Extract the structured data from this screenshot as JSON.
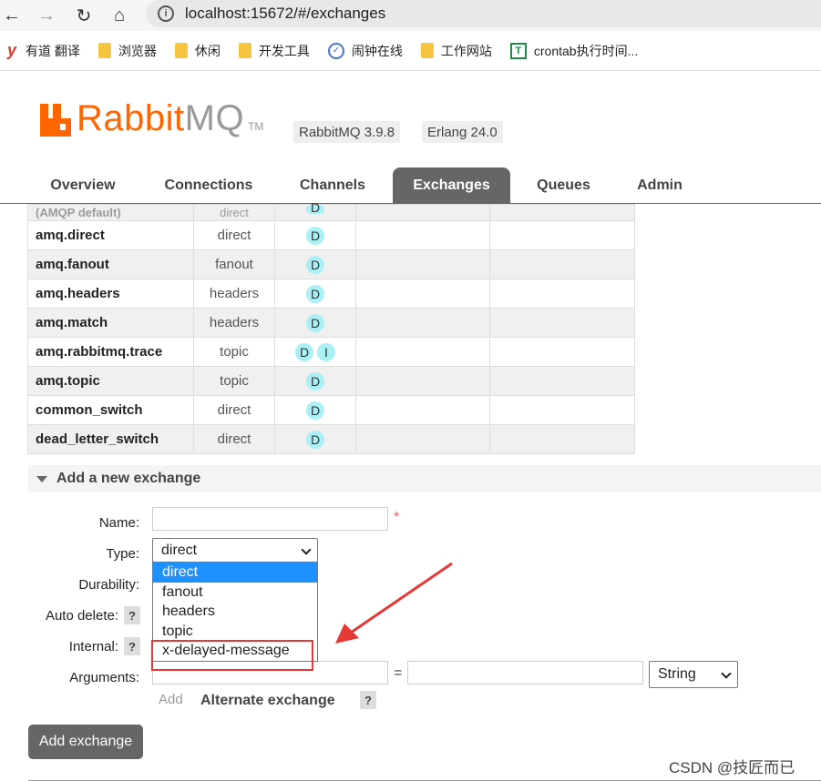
{
  "browser": {
    "url": "localhost:15672/#/exchanges",
    "bookmarks": [
      {
        "icon": "youdao-icon",
        "label": "有道 翻译"
      },
      {
        "icon": "folder-icon",
        "label": "浏览器"
      },
      {
        "icon": "folder-icon",
        "label": "休闲"
      },
      {
        "icon": "folder-icon",
        "label": "开发工具"
      },
      {
        "icon": "clock-check-icon",
        "label": "闹钟在线"
      },
      {
        "icon": "folder-icon",
        "label": "工作网站"
      },
      {
        "icon": "sheet-icon",
        "label": "crontab执行时间..."
      }
    ]
  },
  "header": {
    "logo_rabbit": "Rabbit",
    "logo_mq": "MQ",
    "logo_tm": "TM",
    "version": "RabbitMQ 3.9.8",
    "erlang": "Erlang 24.0",
    "brand_color": "#ff6600"
  },
  "tabs": [
    {
      "label": "Overview",
      "active": false
    },
    {
      "label": "Connections",
      "active": false
    },
    {
      "label": "Channels",
      "active": false
    },
    {
      "label": "Exchanges",
      "active": true
    },
    {
      "label": "Queues",
      "active": false
    },
    {
      "label": "Admin",
      "active": false
    }
  ],
  "exchanges": {
    "partial_row": {
      "name": "(AMQP default)",
      "type": "direct",
      "features": [
        "D"
      ]
    },
    "rows": [
      {
        "name": "amq.direct",
        "type": "direct",
        "features": [
          "D"
        ]
      },
      {
        "name": "amq.fanout",
        "type": "fanout",
        "features": [
          "D"
        ]
      },
      {
        "name": "amq.headers",
        "type": "headers",
        "features": [
          "D"
        ]
      },
      {
        "name": "amq.match",
        "type": "headers",
        "features": [
          "D"
        ]
      },
      {
        "name": "amq.rabbitmq.trace",
        "type": "topic",
        "features": [
          "D",
          "I"
        ]
      },
      {
        "name": "amq.topic",
        "type": "topic",
        "features": [
          "D"
        ]
      },
      {
        "name": "common_switch",
        "type": "direct",
        "features": [
          "D"
        ]
      },
      {
        "name": "dead_letter_switch",
        "type": "direct",
        "features": [
          "D"
        ]
      }
    ]
  },
  "add_exchange": {
    "title": "Add a new exchange",
    "name_label": "Name:",
    "name_value": "",
    "required_mark": "*",
    "type_label": "Type:",
    "type_value": "direct",
    "type_options": [
      "direct",
      "fanout",
      "headers",
      "topic",
      "x-delayed-message"
    ],
    "durability_label": "Durability:",
    "auto_delete_label": "Auto delete:",
    "internal_label": "Internal:",
    "arguments_label": "Arguments:",
    "help_mark": "?",
    "equals": "=",
    "arg_type_value": "String",
    "add_link": "Add",
    "alternate_exchange": "Alternate exchange",
    "submit": "Add exchange"
  },
  "watermark": "CSDN @技匠而已"
}
